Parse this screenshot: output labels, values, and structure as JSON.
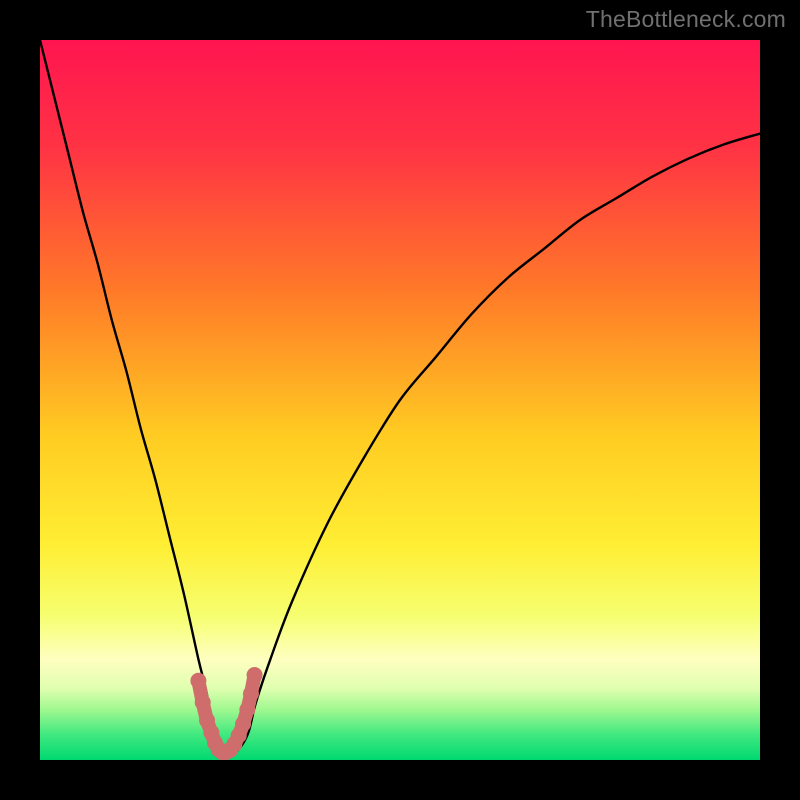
{
  "watermark": "TheBottleneck.com",
  "chart_data": {
    "type": "line",
    "title": "",
    "xlabel": "",
    "ylabel": "",
    "x_range": [
      0,
      100
    ],
    "y_range": [
      0,
      100
    ],
    "min_x": 25,
    "background": {
      "type": "vertical-gradient",
      "stops": [
        {
          "offset": 0.0,
          "color": "#ff1550"
        },
        {
          "offset": 0.15,
          "color": "#ff3344"
        },
        {
          "offset": 0.35,
          "color": "#ff7a28"
        },
        {
          "offset": 0.55,
          "color": "#ffcc22"
        },
        {
          "offset": 0.7,
          "color": "#ffee33"
        },
        {
          "offset": 0.8,
          "color": "#f6ff70"
        },
        {
          "offset": 0.86,
          "color": "#ffffc0"
        },
        {
          "offset": 0.9,
          "color": "#e0ffb0"
        },
        {
          "offset": 0.93,
          "color": "#a0f890"
        },
        {
          "offset": 0.965,
          "color": "#40e880"
        },
        {
          "offset": 1.0,
          "color": "#00d870"
        }
      ]
    },
    "series": [
      {
        "name": "bottleneck-curve",
        "x": [
          0,
          2,
          4,
          6,
          8,
          10,
          12,
          14,
          16,
          18,
          20,
          22,
          23,
          24,
          25,
          26,
          27,
          28,
          29,
          30,
          32,
          35,
          40,
          45,
          50,
          55,
          60,
          65,
          70,
          75,
          80,
          85,
          90,
          95,
          100
        ],
        "y": [
          100,
          92,
          84,
          76,
          69,
          61,
          54,
          46,
          39,
          31,
          23,
          14,
          10,
          5,
          2,
          1,
          1,
          2,
          4,
          8,
          14,
          22,
          33,
          42,
          50,
          56,
          62,
          67,
          71,
          75,
          78,
          81,
          83.5,
          85.5,
          87
        ]
      }
    ],
    "highlight_segment": {
      "color": "#cf6d6d",
      "x": [
        22.0,
        22.6,
        23.2,
        23.8,
        24.3,
        24.8,
        25.3,
        25.8,
        26.4,
        27.0,
        27.6,
        28.2,
        28.8,
        29.3,
        29.8
      ],
      "y": [
        11.0,
        8.0,
        5.5,
        3.8,
        2.4,
        1.5,
        1.1,
        1.1,
        1.4,
        2.2,
        3.4,
        5.0,
        7.0,
        9.2,
        11.8
      ]
    }
  }
}
